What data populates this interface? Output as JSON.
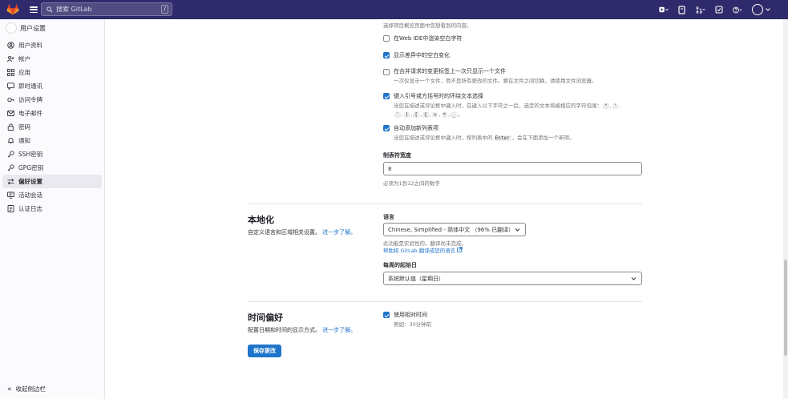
{
  "topbar": {
    "search_placeholder": "搜索 GitLab",
    "search_shortcut": "/"
  },
  "sidebar": {
    "title": "用户设置",
    "items": [
      {
        "label": "用户资料",
        "icon": "user-icon"
      },
      {
        "label": "帐户",
        "icon": "account-icon"
      },
      {
        "label": "应用",
        "icon": "apps-icon"
      },
      {
        "label": "即时通讯",
        "icon": "chat-icon"
      },
      {
        "label": "访问令牌",
        "icon": "token-icon"
      },
      {
        "label": "电子邮件",
        "icon": "mail-icon"
      },
      {
        "label": "密码",
        "icon": "lock-icon"
      },
      {
        "label": "通知",
        "icon": "bell-icon"
      },
      {
        "label": "SSH密钥",
        "icon": "key-icon"
      },
      {
        "label": "GPG密钥",
        "icon": "key-icon"
      },
      {
        "label": "偏好设置",
        "icon": "preferences-icon",
        "active": true
      },
      {
        "label": "活动会话",
        "icon": "monitor-icon"
      },
      {
        "label": "认证日志",
        "icon": "log-icon"
      }
    ],
    "collapse_label": "收起侧边栏"
  },
  "behavior": {
    "top_text": "选择项目概览页面中您想看到的内容。",
    "options": [
      {
        "label": "在Web IDE中渲染空白字符",
        "checked": false
      },
      {
        "label": "显示差异中的空白变化",
        "checked": true
      },
      {
        "label": "在合并请求的变更标签上一次只显示一个文件",
        "help": "一次仅显示一个文件，而不是所有更改的文件。要在文件之间切换，请使用文件浏览器。",
        "checked": false
      },
      {
        "label": "键入引号或方括号时的环绕文本选择",
        "help": "当您在描述或评论框中键入时，在键入以下字符之一后，选定的文本将被相应的字符包围：",
        "checked": true
      },
      {
        "label": "自动添加新列表项",
        "help_pre": "当您在描述或评论框中键入时，按列表中的",
        "help_key": "Enter",
        "help_post": "，会在下面添加一个新项。",
        "checked": true
      }
    ],
    "wrap_chars_row1": [
      "\"",
      "'"
    ],
    "wrap_chars_row2": [
      "`",
      "(",
      "[",
      "{",
      "<",
      "*",
      "_"
    ],
    "wrap_end": "。",
    "tab_width_label": "制表符宽度",
    "tab_width_value": "8",
    "tab_width_help": "必须为1到12之间的数字"
  },
  "localization": {
    "title": "本地化",
    "desc": "自定义语言和区域相关设置。",
    "learn_more": "进一步了解。",
    "language_label": "语言",
    "language_value": "Chinese, Simplified - 简体中文 （96% 已翻译）",
    "language_note": "此功能是实验性的，翻译尚未完成。",
    "help_translate": "帮助将 GitLab 翻译成您的语言",
    "first_day_label": "每周的起始日",
    "first_day_value": "系统默认值（星期日）"
  },
  "time": {
    "title": "时间偏好",
    "desc": "配置日期和时间的显示方式。",
    "learn_more": "进一步了解。",
    "relative_label": "使用相对时间",
    "relative_example": "例如：30分钟前",
    "relative_checked": true
  },
  "save_label": "保存更改",
  "colors": {
    "topbar": "#2f2a6b",
    "primary": "#1f75cb",
    "gitlab_orange": "#e24329"
  }
}
